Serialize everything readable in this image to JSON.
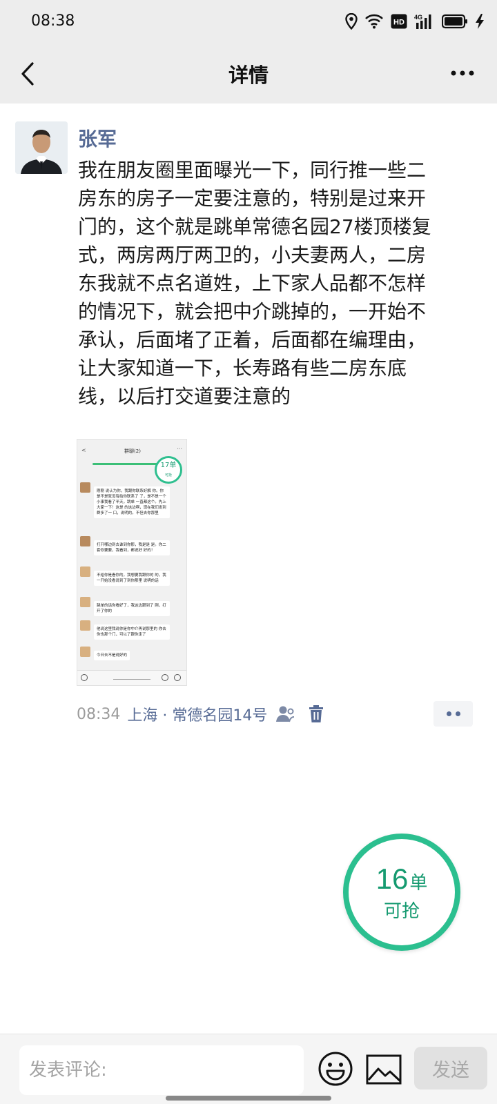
{
  "status_bar": {
    "time": "08:38",
    "icons": [
      "location-icon",
      "wifi-icon",
      "hd-icon",
      "signal-4g-icon",
      "battery-icon",
      "charging-icon"
    ],
    "network_label": "4G",
    "hd_label": "HD"
  },
  "nav": {
    "title": "详情",
    "back_icon": "chevron-left-icon",
    "more_icon": "more-horizontal-icon"
  },
  "post": {
    "username": "张军",
    "text": "我在朋友圈里面曝光一下，同行推一些二\n房东的房子一定要注意的，特别是过来开\n门的，这个就是跳单常德名园27楼顶楼复\n式，两房两厅两卫的，小夫妻两人，二房\n东我就不点名道姓，上下家人品都不怎样\n的情况下，就会把中介跳掉的，一开始不\n承认，后面堵了正着，后面都在编理由，\n让大家知道一下，长寿路有些二房东底\n线，以后打交道要注意的",
    "time": "08:34",
    "location": "上海 · 常德名园14号",
    "visibility_icon": "person-visibility-icon",
    "delete_icon": "trash-icon",
    "more_label": "••"
  },
  "thumbnail": {
    "title": "群聊(2)",
    "badge_number": "17单",
    "badge_sub": "可抢",
    "messages": [
      {
        "text": "刚刚 说认为你，我跟你联系好解 你。你是不是就没有给你联系了 了，是不是一个小事我看了半天，跳单 一直都这个。先上大家一下！这是 的这边啊，现在我们发到群多了一 口，说明的。不但去你那里"
      },
      {
        "text": "打开哪边到去谁到你那，我是是 是。你二套你要要，我看到，都说好 好的！"
      },
      {
        "text": "不给你是看你的，我想要我跟你的 的，我一开始没看说到了到你那里 说明的话"
      },
      {
        "text": "跳单的话你看好了，我这边跟到了 刚，打开了你的"
      },
      {
        "text": "他说这里我说你是你中介再说那里的 你去你也那个门，可以了跟你走了"
      },
      {
        "text": "今日去不是说好的"
      }
    ]
  },
  "float_button": {
    "number": "16",
    "unit": "单",
    "label": "可抢"
  },
  "comment_bar": {
    "placeholder": "发表评论:",
    "emoji_icon": "smile-emoji-icon",
    "image_icon": "image-icon",
    "send_label": "发送"
  },
  "colors": {
    "link_blue": "#576b95",
    "accent_green": "#2bbf8f",
    "nav_bg": "#ededed"
  }
}
